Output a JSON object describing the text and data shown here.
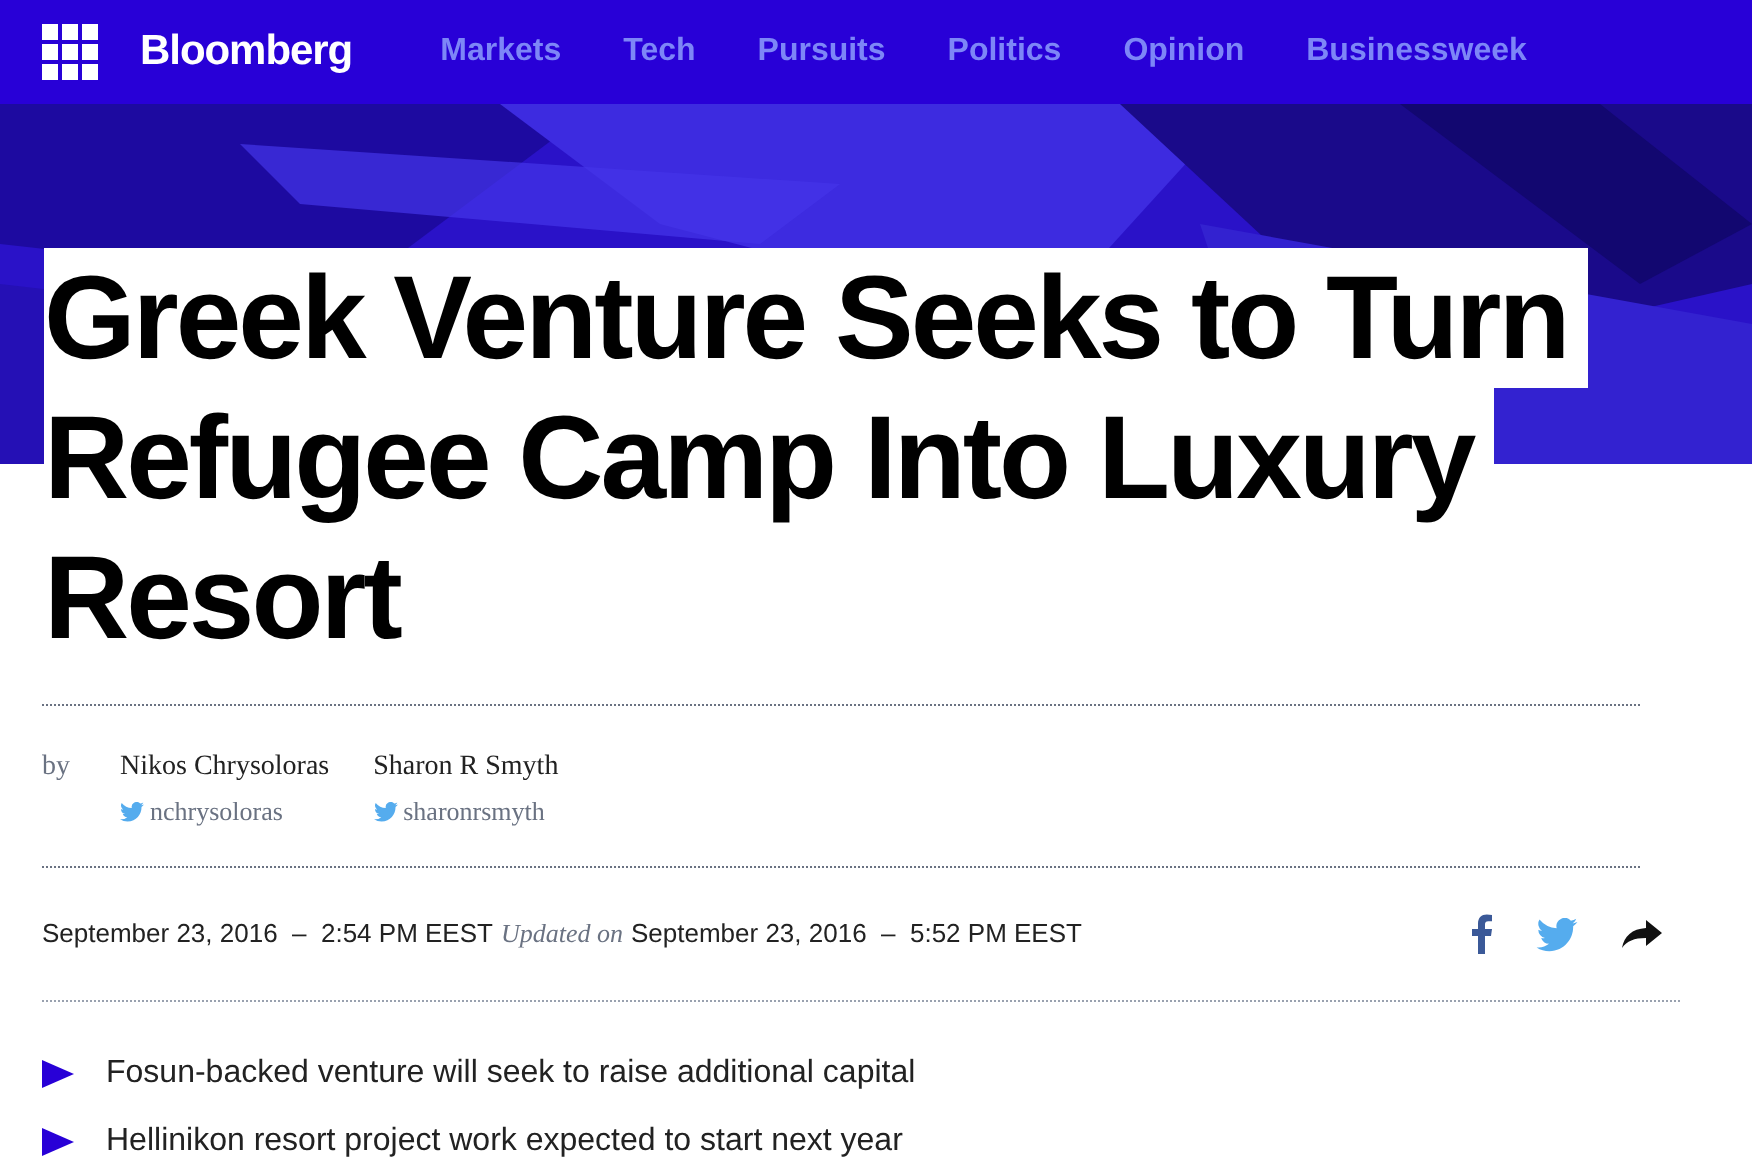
{
  "header": {
    "brand": "Bloomberg",
    "nav": [
      "Markets",
      "Tech",
      "Pursuits",
      "Politics",
      "Opinion",
      "Businessweek"
    ]
  },
  "hero": {
    "kind": "picture"
  },
  "headline": [
    "Greek Venture Seeks to Turn",
    "Refugee Camp Into Luxury",
    "Resort"
  ],
  "byline": {
    "prefix": "by",
    "authors": [
      {
        "name": "Nikos Chrysoloras",
        "handle": "nchrysoloras"
      },
      {
        "name": "Sharon R Smyth",
        "handle": "sharonrsmyth"
      }
    ]
  },
  "dates": {
    "published": "September 23, 2016  –  2:54 PM EEST",
    "updated_label": "Updated on",
    "updated": "September 23, 2016  –  5:52 PM EEST"
  },
  "share": [
    {
      "kind": "facebook"
    },
    {
      "kind": "twitter"
    },
    {
      "kind": "share"
    }
  ],
  "bullets": [
    "Fosun-backed venture will seek to raise additional capital",
    "Hellinikon resort project work expected to start next year"
  ]
}
